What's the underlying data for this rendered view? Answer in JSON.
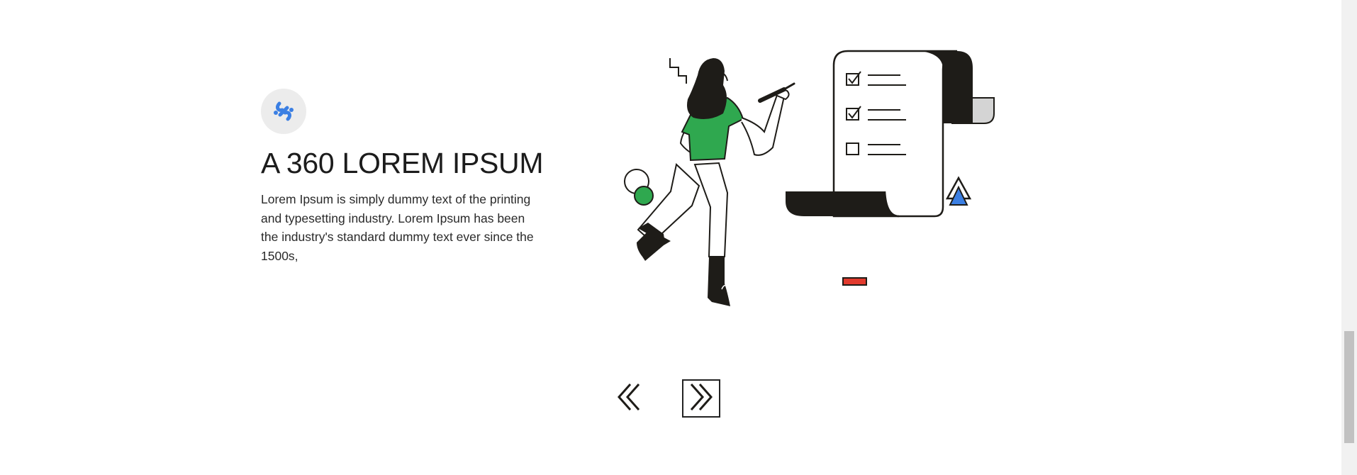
{
  "feature": {
    "icon": "link-chain-icon",
    "title": "A 360 LOREM IPSUM",
    "description": "Lorem Ipsum is simply dummy text of the printing and typesetting industry. Lorem Ipsum has been the industry's standard dummy text ever since the 1500s,"
  },
  "illustration": {
    "subject": "woman-checking-checklist-illustration"
  },
  "carousel": {
    "prev_icon": "chevron-double-left-icon",
    "next_icon": "chevron-double-right-icon"
  },
  "colors": {
    "accent_blue": "#3b7fe3",
    "accent_green": "#2fa84f",
    "accent_red": "#e23b2e",
    "ink": "#1e1c18",
    "text": "#1c1c1c"
  }
}
